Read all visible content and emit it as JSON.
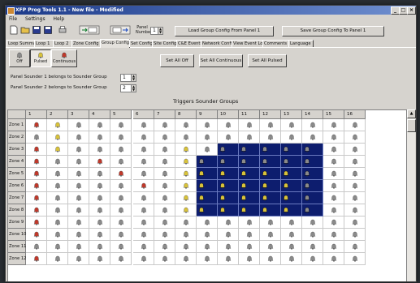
{
  "window": {
    "title": "XFP Prog Tools 1.1 - New file - Modified"
  },
  "menu": [
    "File",
    "Settings",
    "Help"
  ],
  "toolbar": {
    "panel_number_label": "Panel Number",
    "panel_number_value": "1",
    "load_button": "Load Group Config From Panel 1",
    "save_button": "Save Group Config To Panel 1"
  },
  "tabs": [
    "Loop Summary",
    "Loop 1",
    "Loop 2",
    "Zone Config",
    "Group Config",
    "Set Config",
    "Site Config",
    "C&E Events",
    "Network Config",
    "View Event Log",
    "Comments",
    "Language"
  ],
  "active_tab": "Group Config",
  "modes": {
    "off": "Off",
    "pulsed": "Pulsed",
    "continuous": "Continuous",
    "active": "Pulsed"
  },
  "actions": {
    "set_all_off": "Set All Off",
    "set_all_continuous": "Set All Continuous",
    "set_all_pulsed": "Set All Pulsed"
  },
  "sounder_groups": {
    "line1_label": "Panel Sounder 1 belongs to Sounder Group",
    "line1_value": "1",
    "line2_label": "Panel Sounder 2 belongs to Sounder Group",
    "line2_value": "2"
  },
  "grid": {
    "title": "Triggers Sounder Groups",
    "columns": [
      "1",
      "2",
      "3",
      "4",
      "5",
      "6",
      "7",
      "8",
      "9",
      "10",
      "11",
      "12",
      "13",
      "14",
      "15",
      "16"
    ],
    "rows": [
      {
        "label": "Zone 1",
        "cells": [
          "C",
          "P",
          "O",
          "O",
          "O",
          "O",
          "O",
          "O",
          "O",
          "O",
          "O",
          "O",
          "O",
          "O",
          "O",
          "O"
        ]
      },
      {
        "label": "Zone 2",
        "cells": [
          "O",
          "P",
          "O",
          "O",
          "O",
          "O",
          "O",
          "O",
          "O",
          "O",
          "O",
          "O",
          "O",
          "O",
          "O",
          "O"
        ]
      },
      {
        "label": "Zone 3",
        "cells": [
          "C",
          "P",
          "O",
          "O",
          "O",
          "O",
          "O",
          "P",
          "O",
          "O",
          "O",
          "O",
          "O",
          "O",
          "O",
          "O"
        ]
      },
      {
        "label": "Zone 4",
        "cells": [
          "C",
          "O",
          "O",
          "C",
          "O",
          "O",
          "O",
          "P",
          "O",
          "O",
          "O",
          "O",
          "O",
          "O",
          "O",
          "O"
        ]
      },
      {
        "label": "Zone 5",
        "cells": [
          "C",
          "O",
          "O",
          "O",
          "C",
          "O",
          "O",
          "P",
          "P",
          "P",
          "P",
          "P",
          "P",
          "O",
          "O",
          "O"
        ]
      },
      {
        "label": "Zone 6",
        "cells": [
          "C",
          "O",
          "O",
          "O",
          "O",
          "C",
          "O",
          "P",
          "P",
          "P",
          "P",
          "P",
          "P",
          "O",
          "O",
          "O"
        ]
      },
      {
        "label": "Zone 7",
        "cells": [
          "C",
          "O",
          "O",
          "O",
          "O",
          "O",
          "O",
          "P",
          "P",
          "P",
          "P",
          "P",
          "P",
          "O",
          "O",
          "O"
        ]
      },
      {
        "label": "Zone 8",
        "cells": [
          "C",
          "O",
          "O",
          "O",
          "O",
          "O",
          "O",
          "P",
          "P",
          "P",
          "P",
          "P",
          "P",
          "O",
          "O",
          "O"
        ]
      },
      {
        "label": "Zone 9",
        "cells": [
          "C",
          "O",
          "O",
          "O",
          "O",
          "O",
          "O",
          "O",
          "O",
          "O",
          "O",
          "O",
          "O",
          "O",
          "O",
          "O"
        ]
      },
      {
        "label": "Zone 10",
        "cells": [
          "C",
          "O",
          "O",
          "O",
          "O",
          "O",
          "O",
          "O",
          "O",
          "O",
          "O",
          "O",
          "O",
          "O",
          "O",
          "O"
        ]
      },
      {
        "label": "Zone 11",
        "cells": [
          "O",
          "O",
          "O",
          "O",
          "O",
          "O",
          "O",
          "O",
          "O",
          "O",
          "O",
          "O",
          "O",
          "O",
          "O",
          "O"
        ]
      },
      {
        "label": "Zone 12",
        "cells": [
          "C",
          "O",
          "O",
          "O",
          "O",
          "O",
          "O",
          "O",
          "O",
          "O",
          "O",
          "O",
          "O",
          "O",
          "O",
          "O"
        ]
      }
    ],
    "selected": [
      [
        3,
        8
      ],
      [
        3,
        9
      ],
      [
        3,
        10
      ],
      [
        3,
        11
      ],
      [
        3,
        12
      ],
      [
        3,
        13
      ],
      [
        4,
        8
      ],
      [
        4,
        9
      ],
      [
        4,
        10
      ],
      [
        4,
        11
      ],
      [
        4,
        12
      ],
      [
        4,
        13
      ],
      [
        5,
        8
      ],
      [
        5,
        9
      ],
      [
        5,
        10
      ],
      [
        5,
        11
      ],
      [
        5,
        12
      ],
      [
        5,
        13
      ],
      [
        6,
        8
      ],
      [
        6,
        9
      ],
      [
        6,
        10
      ],
      [
        6,
        11
      ],
      [
        6,
        12
      ],
      [
        6,
        13
      ],
      [
        7,
        8
      ],
      [
        7,
        9
      ],
      [
        7,
        10
      ],
      [
        7,
        11
      ],
      [
        7,
        12
      ],
      [
        7,
        13
      ],
      [
        2,
        9
      ],
      [
        2,
        10
      ],
      [
        2,
        11
      ],
      [
        2,
        12
      ],
      [
        2,
        13
      ]
    ]
  },
  "colors": {
    "off_bell": "#8a8a8a",
    "pulsed_bell": "#d8c23a",
    "continuous_bell": "#c0392b",
    "selection": "#0d1d6e",
    "title_bar": "#1c3a8a"
  },
  "icons": [
    "new-file-icon",
    "open-folder-icon",
    "save-icon",
    "save-all-icon",
    "print-icon",
    "read-from-panel-icon",
    "write-to-panel-icon"
  ]
}
